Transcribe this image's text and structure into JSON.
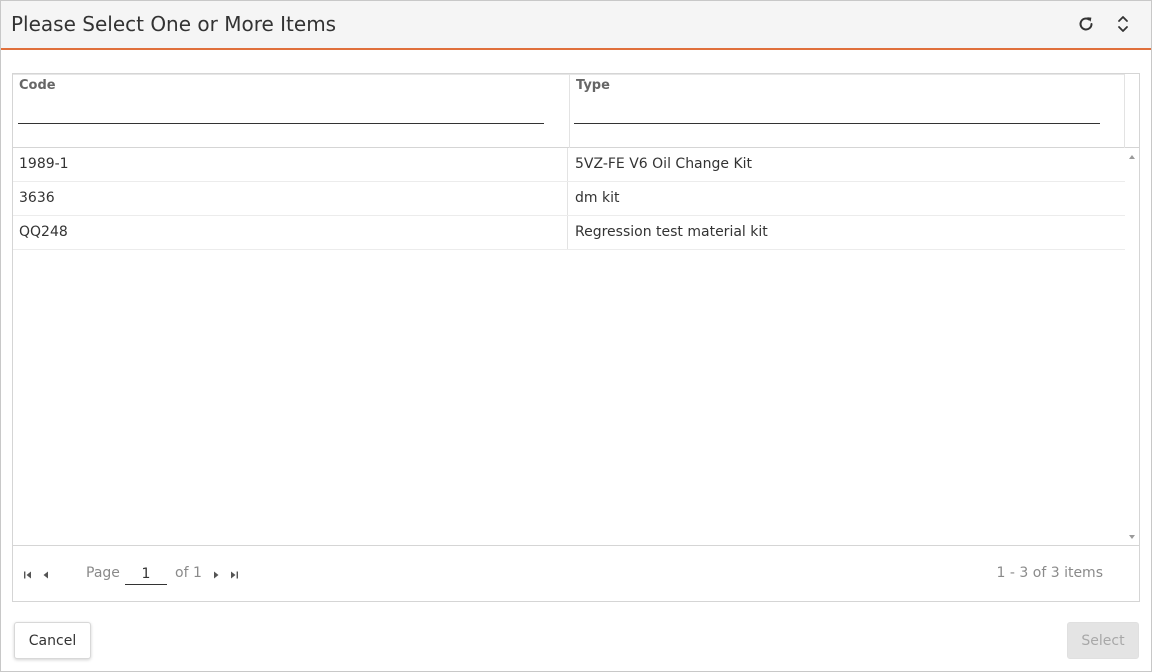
{
  "dialog": {
    "title": "Please Select One or More Items",
    "icons": {
      "refresh": "refresh-icon",
      "expand": "expand-collapse-icon"
    },
    "accent_color": "#e0703c"
  },
  "grid": {
    "columns": [
      {
        "key": "code",
        "label": "Code",
        "filter_value": ""
      },
      {
        "key": "type",
        "label": "Type",
        "filter_value": ""
      }
    ],
    "rows": [
      {
        "code": "1989-1",
        "type": "5VZ-FE V6 Oil Change Kit"
      },
      {
        "code": "3636",
        "type": "dm kit"
      },
      {
        "code": "QQ248",
        "type": "Regression test material kit"
      }
    ]
  },
  "pager": {
    "page_label": "Page",
    "current_page": "1",
    "of_label": "of 1",
    "summary": "1 - 3 of 3 items",
    "icons": {
      "first": "first-page-icon",
      "prev": "previous-page-icon",
      "next": "next-page-icon",
      "last": "last-page-icon"
    }
  },
  "buttons": {
    "cancel_label": "Cancel",
    "select_label": "Select"
  }
}
